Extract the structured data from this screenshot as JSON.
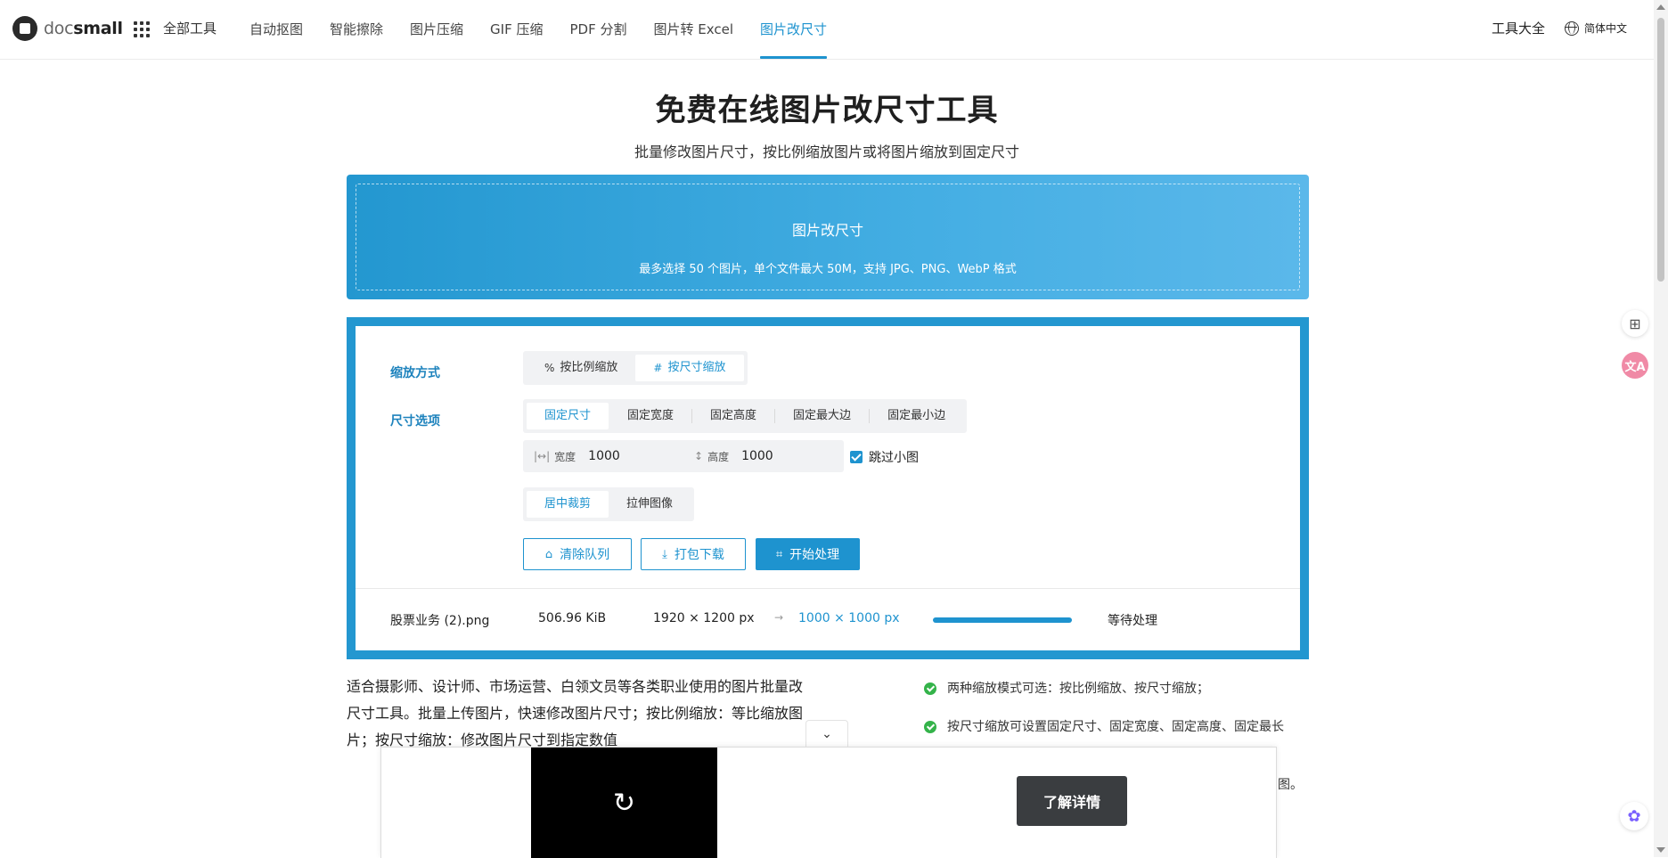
{
  "header": {
    "logo_prefix": "doc",
    "logo_suffix": "small",
    "all_tools": "全部工具",
    "nav": [
      {
        "label": "自动抠图"
      },
      {
        "label": "智能擦除"
      },
      {
        "label": "图片压缩"
      },
      {
        "label": "GIF 压缩"
      },
      {
        "label": "PDF 分割"
      },
      {
        "label": "图片转 Excel"
      },
      {
        "label": "图片改尺寸",
        "active": true
      }
    ],
    "tool_all": "工具大全",
    "language": "简体中文"
  },
  "hero": {
    "title": "免费在线图片改尺寸工具",
    "subtitle": "批量修改图片尺寸，按比例缩放图片或将图片缩放到固定尺寸"
  },
  "upload": {
    "title": "图片改尺寸",
    "hint": "最多选择 50 个图片，单个文件最大 50M，支持 JPG、PNG、WebP 格式"
  },
  "settings": {
    "scale_mode_label": "缩放方式",
    "scale_modes": [
      "按比例缩放",
      "按尺寸缩放"
    ],
    "scale_mode_selected": "按尺寸缩放",
    "size_option_label": "尺寸选项",
    "size_options": [
      "固定尺寸",
      "固定宽度",
      "固定高度",
      "固定最大边",
      "固定最小边"
    ],
    "size_option_selected": "固定尺寸",
    "width_label": "宽度",
    "width_value": "1000",
    "height_label": "高度",
    "height_value": "1000",
    "skip_small_label": "跳过小图",
    "skip_small_checked": true,
    "fit_modes": [
      "居中裁剪",
      "拉伸图像"
    ],
    "fit_mode_selected": "居中裁剪",
    "clear_queue": "清除队列",
    "download_zip": "打包下载",
    "start": "开始处理"
  },
  "queue": [
    {
      "filename": "股票业务 (2).png",
      "size": "506.96 KiB",
      "original_dims": "1920 × 1200 px",
      "arrow": "→",
      "target_dims": "1000 × 1000 px",
      "progress": 1.0,
      "status": "等待处理"
    }
  ],
  "description": "适合摄影师、设计师、市场运营、白领文员等各类职业使用的图片批量改尺寸工具。批量上传图片，快速修改图片尺寸；按比例缩放：等比缩放图片；按尺寸缩放：修改图片尺寸到指定数值",
  "features": [
    "两种缩放模式可选：按比例缩放、按尺寸缩放；",
    "按尺寸缩放可设置固定尺寸、固定宽度、固定高度、固定最长"
  ],
  "feature_fragment": "图。",
  "ad": {
    "cta": "了解详情",
    "collapse_icon": "chevron-down-icon",
    "video_icon": "replay-icon"
  },
  "colors": {
    "accent": "#1e93cf",
    "label": "#1e83bd",
    "success": "#34b34a",
    "ad_cta": "#3a3d40"
  }
}
